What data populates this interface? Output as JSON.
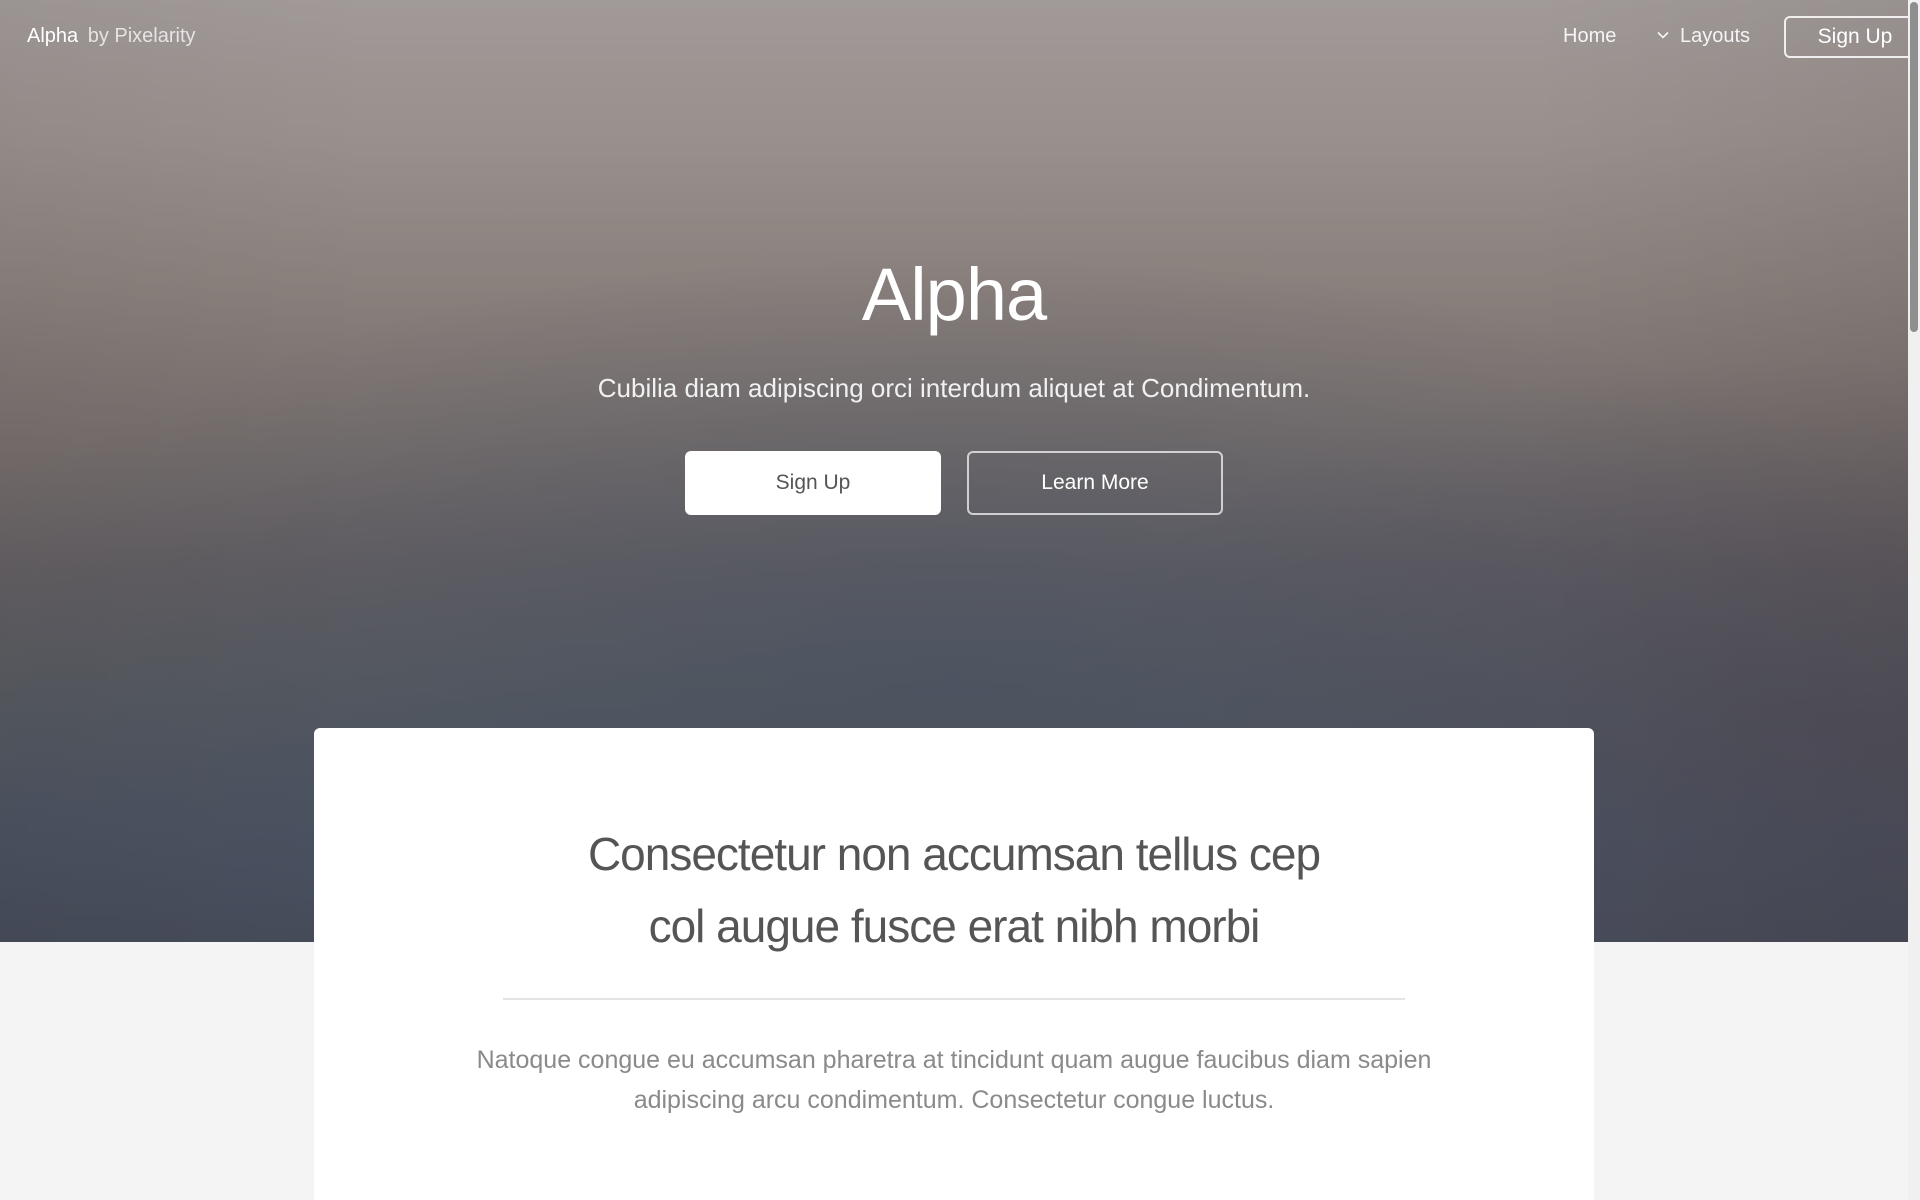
{
  "header": {
    "brand_name": "Alpha",
    "brand_by": "by Pixelarity",
    "nav": {
      "home_label": "Home",
      "layouts_label": "Layouts",
      "layouts_icon": "chevron-down-icon",
      "signup_label": "Sign Up"
    }
  },
  "hero": {
    "title": "Alpha",
    "subtitle": "Cubilia diam adipiscing orci interdum aliquet at Condimentum.",
    "primary_button": "Sign Up",
    "secondary_button": "Learn More"
  },
  "card": {
    "heading_line1": "Consectetur non accumsan tellus cep",
    "heading_line2": "col augue fusce erat nibh morbi",
    "text_line1": "Natoque congue eu accumsan pharetra at tincidunt quam augue faucibus diam sapien",
    "text_line2": "adipiscing arcu condimentum. Consectetur congue luctus."
  },
  "colors": {
    "page_background": "#f4f4f4",
    "card_background": "#ffffff",
    "heading_text": "#555555",
    "body_text": "#8a8a8a"
  }
}
